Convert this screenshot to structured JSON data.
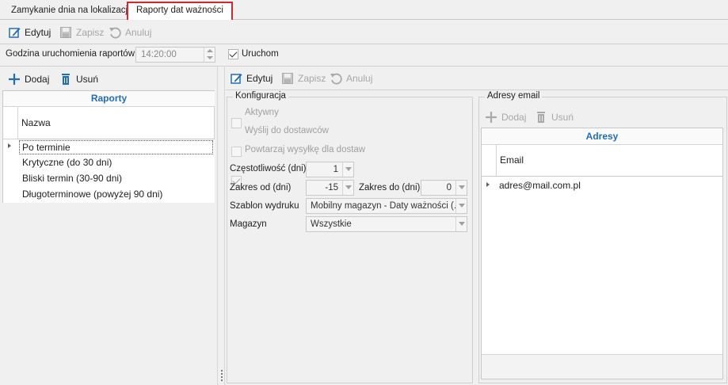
{
  "tabs": [
    {
      "label": "Zamykanie dnia na lokalizacji"
    },
    {
      "label": "Raporty dat ważności"
    }
  ],
  "toolbar": {
    "edit": "Edytuj",
    "save": "Zapisz",
    "cancel": "Anuluj"
  },
  "schedule": {
    "label": "Godzina uruchomienia raportów",
    "time": "14:20:00",
    "run_label": "Uruchom",
    "run_checked": true
  },
  "left": {
    "add": "Dodaj",
    "remove": "Usuń",
    "grid_title": "Raporty",
    "column": "Nazwa",
    "rows": [
      "Po terminie",
      "Krytyczne (do 30 dni)",
      "Bliski termin (30-90 dni)",
      "Długoterminowe (powyżej 90 dni)"
    ]
  },
  "middle": {
    "edit": "Edytuj",
    "save": "Zapisz",
    "cancel": "Anuluj",
    "group_title": "Konfiguracja",
    "active": "Aktywny",
    "send_suppliers": "Wyślij do dostawców",
    "repeat_send": "Powtarzaj wysyłkę dla dostaw",
    "frequency_label": "Częstotliwość (dni)",
    "frequency": "1",
    "range_from_label": "Zakres od (dni)",
    "range_from": "-15",
    "range_to_label": "Zakres do (dni)",
    "range_to": "0",
    "template_label": "Szablon wydruku",
    "template": "Mobilny magazyn - Daty ważności (...",
    "warehouse_label": "Magazyn",
    "warehouse": "Wszystkie"
  },
  "right": {
    "group_title": "Adresy email",
    "add": "Dodaj",
    "remove": "Usuń",
    "grid_title": "Adresy",
    "column": "Email",
    "rows": [
      "adres@mail.com.pl"
    ]
  },
  "colors": {
    "accent_blue": "#1f6dbf",
    "active_tab_border": "#d7262e"
  }
}
